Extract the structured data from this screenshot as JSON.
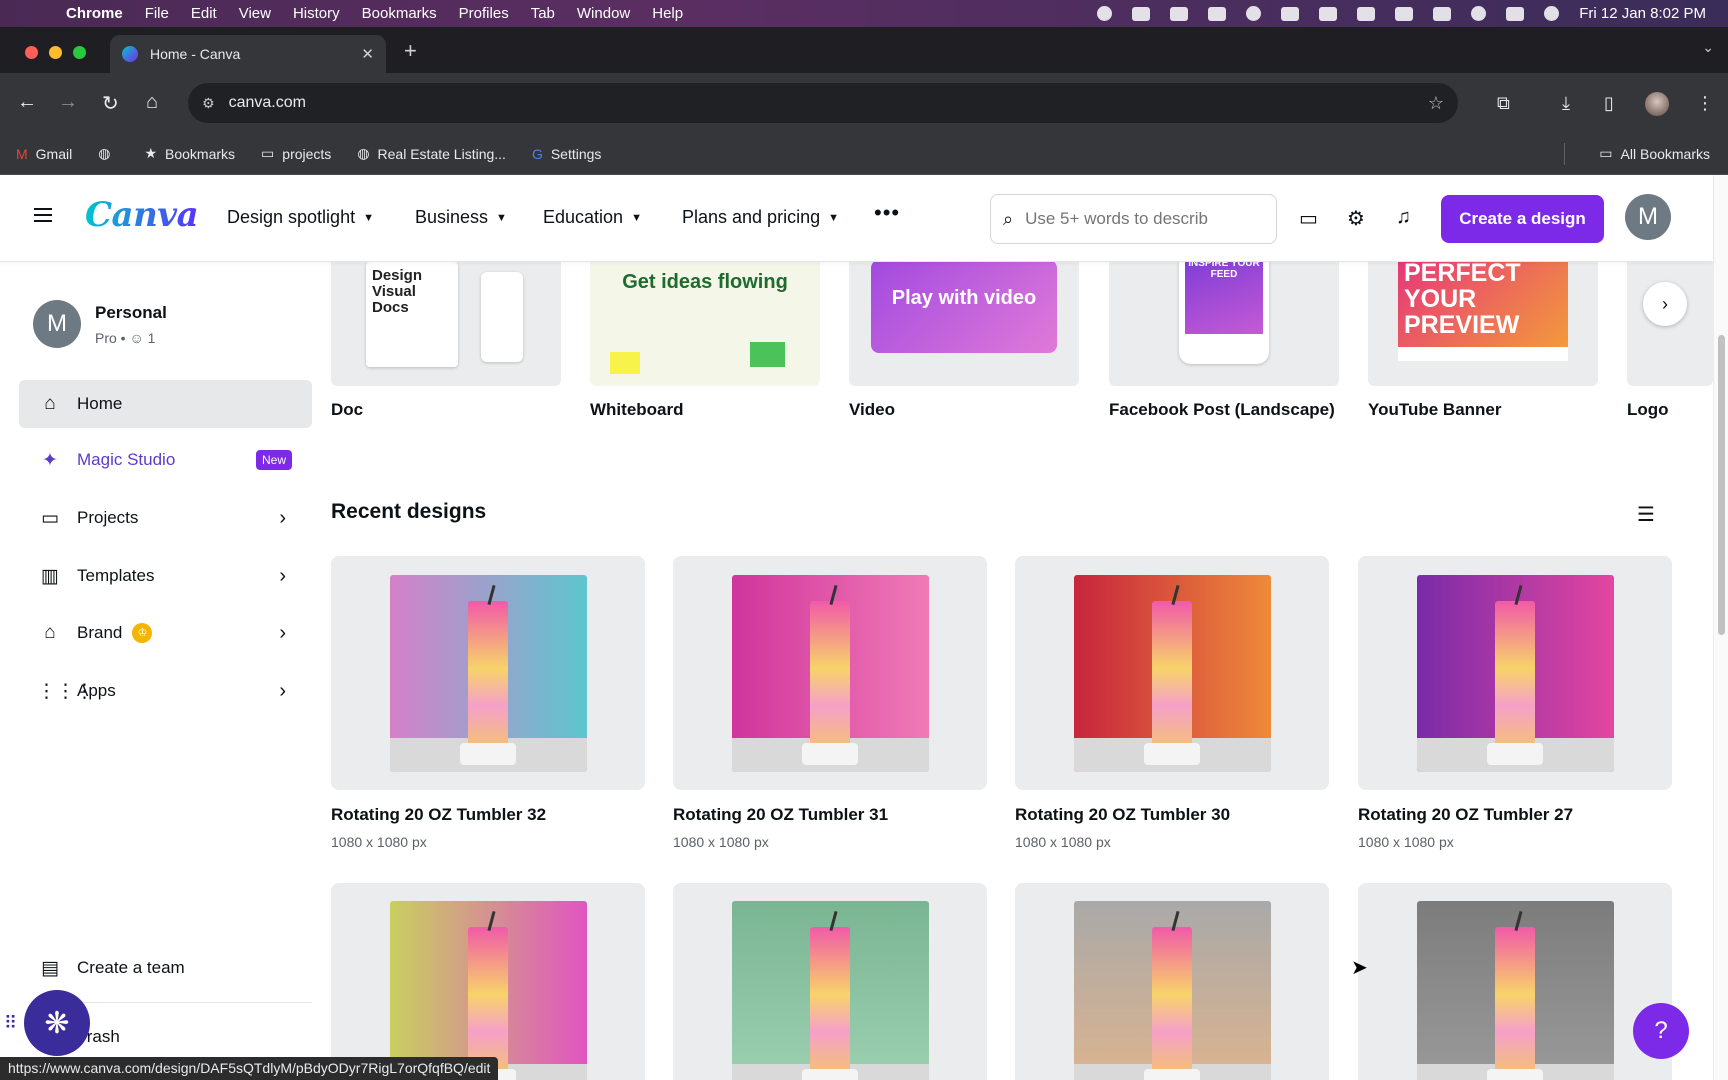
{
  "menubar": {
    "app": "Chrome",
    "items": [
      "File",
      "Edit",
      "View",
      "History",
      "Bookmarks",
      "Profiles",
      "Tab",
      "Window",
      "Help"
    ],
    "clock": "Fri 12 Jan  8:02 PM"
  },
  "browser": {
    "tab_title": "Home - Canva",
    "url": "canva.com",
    "bookmarks": [
      "Gmail",
      "",
      "Bookmarks",
      "projects",
      "Real Estate Listing...",
      "Settings"
    ],
    "all_bookmarks": "All Bookmarks",
    "status_url": "https://www.canva.com/design/DAF5sQTdlyM/pBdyODyr7RigL7orQfqfBQ/edit"
  },
  "header": {
    "logo": "Canva",
    "nav": [
      "Design spotlight",
      "Business",
      "Education",
      "Plans and pricing"
    ],
    "search_placeholder": "Use 5+ words to describ",
    "create_button": "Create a design",
    "avatar_initial": "M"
  },
  "sidebar": {
    "account_initial": "M",
    "account_name": "Personal",
    "account_sub": "Pro • ☺ 1",
    "items": [
      {
        "label": "Home",
        "icon": "home-icon"
      },
      {
        "label": "Magic Studio",
        "icon": "sparkle-icon",
        "badge": "New"
      },
      {
        "label": "Projects",
        "icon": "folder-icon"
      },
      {
        "label": "Templates",
        "icon": "templates-icon"
      },
      {
        "label": "Brand",
        "icon": "brand-icon"
      },
      {
        "label": "Apps",
        "icon": "apps-icon"
      }
    ],
    "create_team": "Create a team",
    "trash": "Trash"
  },
  "templates": [
    {
      "label": "Doc",
      "thumb_text": "Design Visual Docs",
      "bg": "#f1f1ef"
    },
    {
      "label": "Whiteboard",
      "thumb_text": "Get ideas flowing",
      "bg": "#f4f6e8"
    },
    {
      "label": "Video",
      "thumb_text": "Play with video",
      "bg": "#b450e0"
    },
    {
      "label": "Facebook Post (Landscape)",
      "thumb_text": "INSPIRE YOUR FEED",
      "bg": "#7a3bd6"
    },
    {
      "label": "YouTube Banner",
      "thumb_text": "PERFECT YOUR PREVIEW",
      "bg": "#e5357a"
    },
    {
      "label": "Logo",
      "thumb_text": "",
      "bg": "#e8e8e8"
    }
  ],
  "recent": {
    "title": "Recent designs",
    "designs": [
      {
        "title": "Rotating 20 OZ Tumbler 32",
        "size": "1080 x 1080 px",
        "bg": "linear-gradient(90deg,#d580c9,#5dc6cf)"
      },
      {
        "title": "Rotating 20 OZ Tumbler 31",
        "size": "1080 x 1080 px",
        "bg": "linear-gradient(90deg,#d0359c,#f07ab6)"
      },
      {
        "title": "Rotating 20 OZ Tumbler 30",
        "size": "1080 x 1080 px",
        "bg": "linear-gradient(90deg,#c7253d,#ee8a3a)"
      },
      {
        "title": "Rotating 20 OZ Tumbler 27",
        "size": "1080 x 1080 px",
        "bg": "linear-gradient(90deg,#7a2ba8,#e446a0)"
      },
      {
        "title": "",
        "size": "",
        "bg": "linear-gradient(90deg,#c9cf60,#e055c0)"
      },
      {
        "title": "",
        "size": "",
        "bg": "linear-gradient(180deg,#7ab592,#9fd3b5)"
      },
      {
        "title": "",
        "size": "",
        "bg": "linear-gradient(180deg,#a9a9a9,#e0b58c)"
      },
      {
        "title": "",
        "size": "",
        "bg": "linear-gradient(180deg,#7c7c7c,#9d9d9d)"
      }
    ]
  },
  "colors": {
    "brand_purple": "#7d2ae8",
    "active_nav": "#e7e8ea"
  }
}
